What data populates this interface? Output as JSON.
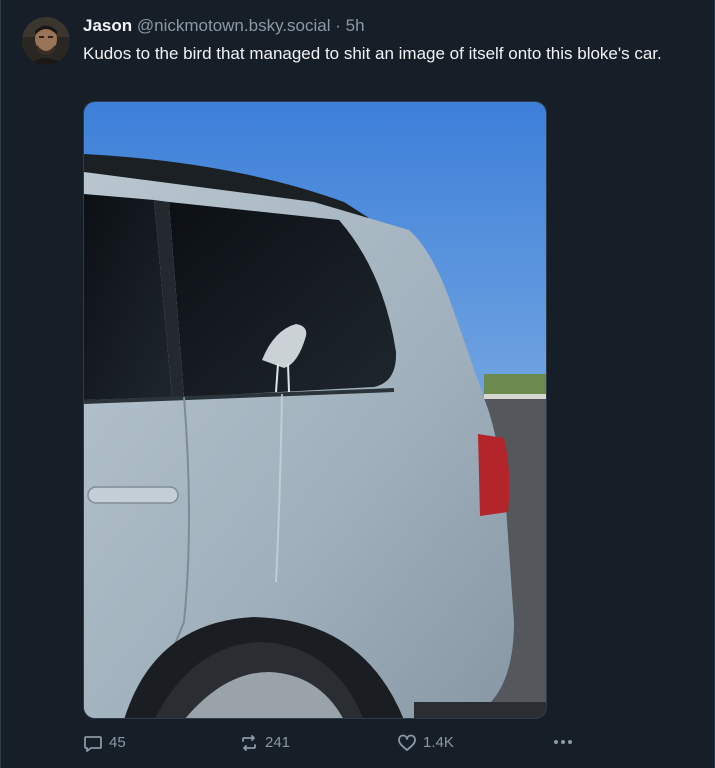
{
  "post": {
    "author_name": "Jason",
    "handle": "@nickmotown.bsky.social",
    "separator": "·",
    "time": "5h",
    "text": "Kudos to the bird that managed to shit an image of itself onto this bloke's car.",
    "avatar_icon": "user-avatar-photo",
    "image_icon": "photo-car-with-bird-dropping"
  },
  "actions": {
    "replies": "45",
    "reposts": "241",
    "likes": "1.4K",
    "reply_icon": "speech-bubble-icon",
    "repost_icon": "repost-arrows-icon",
    "like_icon": "heart-icon",
    "more_icon": "ellipsis-icon"
  },
  "colors": {
    "background": "#161e27",
    "text": "#f1f3f5",
    "muted": "#8b98a5"
  }
}
